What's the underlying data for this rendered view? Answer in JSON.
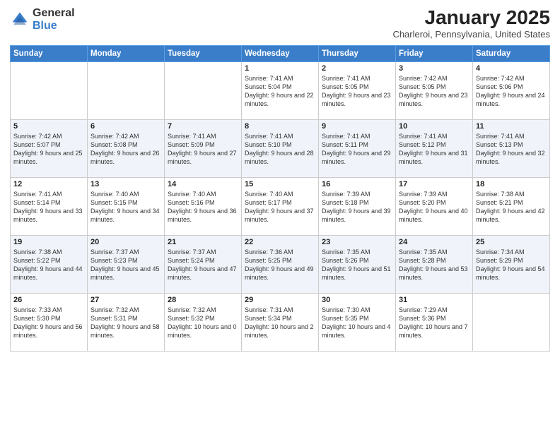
{
  "header": {
    "logo_general": "General",
    "logo_blue": "Blue",
    "title": "January 2025",
    "location": "Charleroi, Pennsylvania, United States"
  },
  "weekdays": [
    "Sunday",
    "Monday",
    "Tuesday",
    "Wednesday",
    "Thursday",
    "Friday",
    "Saturday"
  ],
  "weeks": [
    [
      {
        "day": "",
        "detail": ""
      },
      {
        "day": "",
        "detail": ""
      },
      {
        "day": "",
        "detail": ""
      },
      {
        "day": "1",
        "detail": "Sunrise: 7:41 AM\nSunset: 5:04 PM\nDaylight: 9 hours\nand 22 minutes."
      },
      {
        "day": "2",
        "detail": "Sunrise: 7:41 AM\nSunset: 5:05 PM\nDaylight: 9 hours\nand 23 minutes."
      },
      {
        "day": "3",
        "detail": "Sunrise: 7:42 AM\nSunset: 5:05 PM\nDaylight: 9 hours\nand 23 minutes."
      },
      {
        "day": "4",
        "detail": "Sunrise: 7:42 AM\nSunset: 5:06 PM\nDaylight: 9 hours\nand 24 minutes."
      }
    ],
    [
      {
        "day": "5",
        "detail": "Sunrise: 7:42 AM\nSunset: 5:07 PM\nDaylight: 9 hours\nand 25 minutes."
      },
      {
        "day": "6",
        "detail": "Sunrise: 7:42 AM\nSunset: 5:08 PM\nDaylight: 9 hours\nand 26 minutes."
      },
      {
        "day": "7",
        "detail": "Sunrise: 7:41 AM\nSunset: 5:09 PM\nDaylight: 9 hours\nand 27 minutes."
      },
      {
        "day": "8",
        "detail": "Sunrise: 7:41 AM\nSunset: 5:10 PM\nDaylight: 9 hours\nand 28 minutes."
      },
      {
        "day": "9",
        "detail": "Sunrise: 7:41 AM\nSunset: 5:11 PM\nDaylight: 9 hours\nand 29 minutes."
      },
      {
        "day": "10",
        "detail": "Sunrise: 7:41 AM\nSunset: 5:12 PM\nDaylight: 9 hours\nand 31 minutes."
      },
      {
        "day": "11",
        "detail": "Sunrise: 7:41 AM\nSunset: 5:13 PM\nDaylight: 9 hours\nand 32 minutes."
      }
    ],
    [
      {
        "day": "12",
        "detail": "Sunrise: 7:41 AM\nSunset: 5:14 PM\nDaylight: 9 hours\nand 33 minutes."
      },
      {
        "day": "13",
        "detail": "Sunrise: 7:40 AM\nSunset: 5:15 PM\nDaylight: 9 hours\nand 34 minutes."
      },
      {
        "day": "14",
        "detail": "Sunrise: 7:40 AM\nSunset: 5:16 PM\nDaylight: 9 hours\nand 36 minutes."
      },
      {
        "day": "15",
        "detail": "Sunrise: 7:40 AM\nSunset: 5:17 PM\nDaylight: 9 hours\nand 37 minutes."
      },
      {
        "day": "16",
        "detail": "Sunrise: 7:39 AM\nSunset: 5:18 PM\nDaylight: 9 hours\nand 39 minutes."
      },
      {
        "day": "17",
        "detail": "Sunrise: 7:39 AM\nSunset: 5:20 PM\nDaylight: 9 hours\nand 40 minutes."
      },
      {
        "day": "18",
        "detail": "Sunrise: 7:38 AM\nSunset: 5:21 PM\nDaylight: 9 hours\nand 42 minutes."
      }
    ],
    [
      {
        "day": "19",
        "detail": "Sunrise: 7:38 AM\nSunset: 5:22 PM\nDaylight: 9 hours\nand 44 minutes."
      },
      {
        "day": "20",
        "detail": "Sunrise: 7:37 AM\nSunset: 5:23 PM\nDaylight: 9 hours\nand 45 minutes."
      },
      {
        "day": "21",
        "detail": "Sunrise: 7:37 AM\nSunset: 5:24 PM\nDaylight: 9 hours\nand 47 minutes."
      },
      {
        "day": "22",
        "detail": "Sunrise: 7:36 AM\nSunset: 5:25 PM\nDaylight: 9 hours\nand 49 minutes."
      },
      {
        "day": "23",
        "detail": "Sunrise: 7:35 AM\nSunset: 5:26 PM\nDaylight: 9 hours\nand 51 minutes."
      },
      {
        "day": "24",
        "detail": "Sunrise: 7:35 AM\nSunset: 5:28 PM\nDaylight: 9 hours\nand 53 minutes."
      },
      {
        "day": "25",
        "detail": "Sunrise: 7:34 AM\nSunset: 5:29 PM\nDaylight: 9 hours\nand 54 minutes."
      }
    ],
    [
      {
        "day": "26",
        "detail": "Sunrise: 7:33 AM\nSunset: 5:30 PM\nDaylight: 9 hours\nand 56 minutes."
      },
      {
        "day": "27",
        "detail": "Sunrise: 7:32 AM\nSunset: 5:31 PM\nDaylight: 9 hours\nand 58 minutes."
      },
      {
        "day": "28",
        "detail": "Sunrise: 7:32 AM\nSunset: 5:32 PM\nDaylight: 10 hours\nand 0 minutes."
      },
      {
        "day": "29",
        "detail": "Sunrise: 7:31 AM\nSunset: 5:34 PM\nDaylight: 10 hours\nand 2 minutes."
      },
      {
        "day": "30",
        "detail": "Sunrise: 7:30 AM\nSunset: 5:35 PM\nDaylight: 10 hours\nand 4 minutes."
      },
      {
        "day": "31",
        "detail": "Sunrise: 7:29 AM\nSunset: 5:36 PM\nDaylight: 10 hours\nand 7 minutes."
      },
      {
        "day": "",
        "detail": ""
      }
    ]
  ]
}
